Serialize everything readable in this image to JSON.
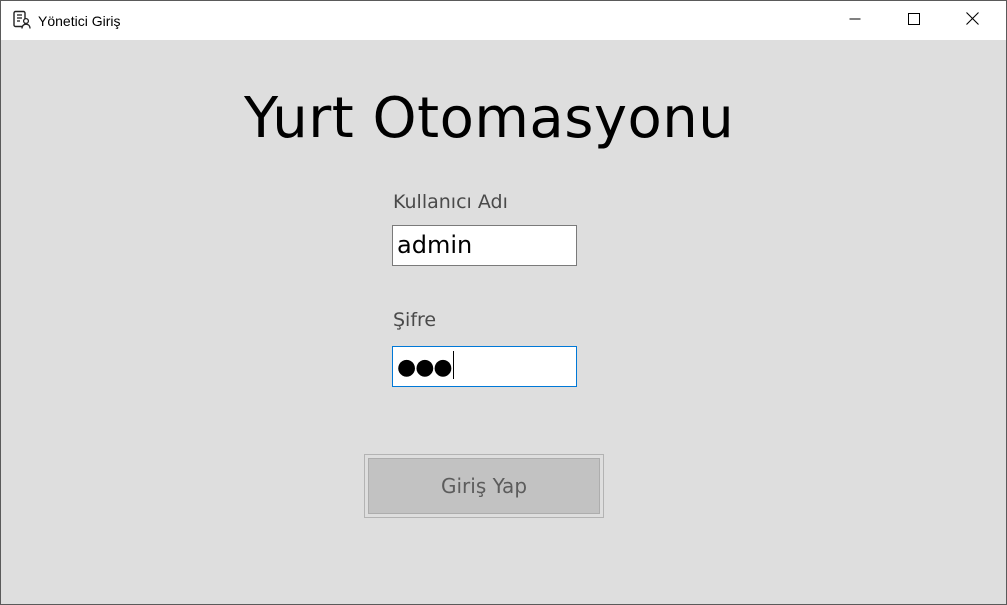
{
  "window": {
    "title": "Yönetici Giriş",
    "app_icon": "form-user-icon",
    "controls": {
      "minimize_icon": "minimize-icon",
      "maximize_icon": "maximize-icon",
      "close_icon": "close-icon"
    }
  },
  "form": {
    "heading": "Yurt Otomasyonu",
    "username": {
      "label": "Kullanıcı Adı",
      "value": "admin"
    },
    "password": {
      "label": "Şifre",
      "masked_value": "●●●",
      "focused": true
    },
    "submit_label": "Giriş Yap"
  },
  "colors": {
    "client_background": "#dedede",
    "focus_border": "#0078d7",
    "button_face": "#c2c2c2"
  }
}
